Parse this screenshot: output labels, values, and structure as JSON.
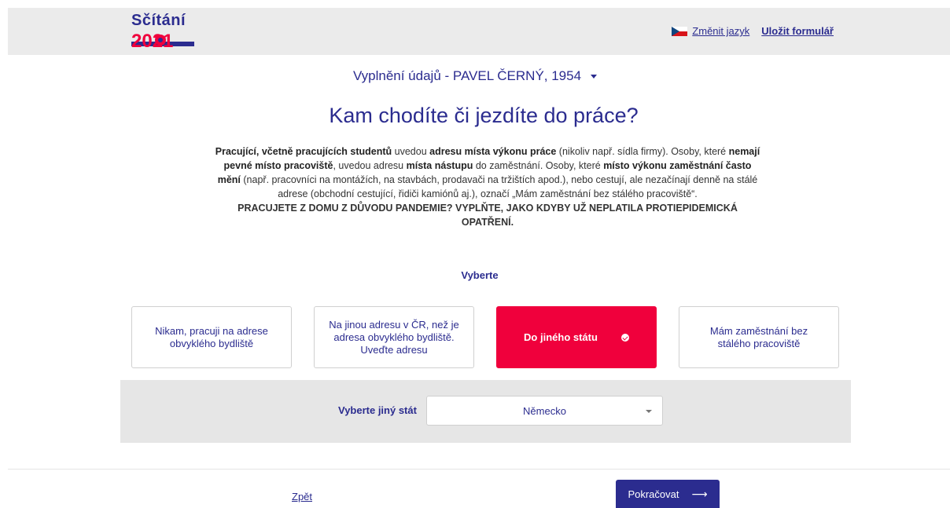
{
  "header": {
    "logo_text": "Sčítání",
    "logo_year": "2021",
    "change_language": "Změnit jazyk",
    "save_form": "Uložit formulář"
  },
  "person_selector": "Vyplnění údajů - PAVEL ČERNÝ, 1954",
  "title": "Kam chodíte či jezdíte do práce?",
  "description": {
    "part1_bold": "Pracující, včetně pracujících studentů",
    "part2": " uvedou ",
    "part3_bold": "adresu místa výkonu práce",
    "part4": " (nikoliv např. sídla firmy). Osoby, které ",
    "part5_bold": "nemají pevné místo pracoviště",
    "part6": ", uvedou adresu ",
    "part7_bold": "místa nástupu",
    "part8": " do zaměstnání. Osoby, které ",
    "part9_bold": "místo výkonu zaměstnání často mění",
    "part10": " (např. pracovníci na montážích, na stavbách, prodavači na tržištích apod.), nebo cestují, ale nezačínají denně na stálé adrese (obchodní cestující, řidiči kamiónů aj.), označí „Mám zaměstnání bez stálého pracoviště“.",
    "caps": "PRACUJETE Z DOMU Z DŮVODU PANDEMIE? VYPLŇTE, JAKO KDYBY UŽ NEPLATILA PROTIEPIDEMICKÁ OPATŘENÍ."
  },
  "choose_label": "Vyberte",
  "options": [
    {
      "label": "Nikam, pracuji na adrese obvyklého bydliště",
      "selected": false
    },
    {
      "label": "Na jinou adresu v ČR, než je adresa obvyklého bydliště. Uveďte adresu",
      "selected": false
    },
    {
      "label": "Do jiného státu",
      "selected": true
    },
    {
      "label": "Mám zaměstnání bez stálého pracoviště",
      "selected": false
    }
  ],
  "country_panel": {
    "label": "Vyberte jiný stát",
    "selected_value": "Německo"
  },
  "footer": {
    "back": "Zpět",
    "next": "Pokračovat"
  },
  "colors": {
    "brand": "#2b2c8f",
    "accent": "#f0003c"
  },
  "icons": [
    "czech-flag-icon",
    "chevron-down-icon",
    "check-circle-icon",
    "arrow-right-icon"
  ]
}
